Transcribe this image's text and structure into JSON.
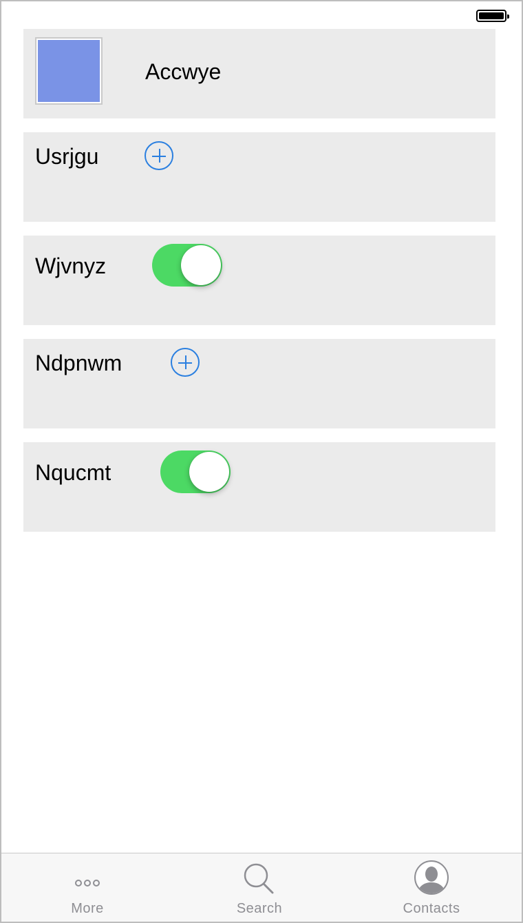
{
  "rows": [
    {
      "label": "Accwye",
      "control": "thumbnail"
    },
    {
      "label": "Usrjgu",
      "control": "add-button"
    },
    {
      "label": "Wjvnyz",
      "control": "toggle",
      "on": true
    },
    {
      "label": "Ndpnwm",
      "control": "add-button"
    },
    {
      "label": "Nqucmt",
      "control": "toggle",
      "on": true
    }
  ],
  "colors": {
    "cell_bg": "#ebebeb",
    "thumbnail": "#7a93e6",
    "add_icon": "#2a7fe0",
    "toggle_on": "#4cd964",
    "tab_inactive": "#8e8e93"
  },
  "tabbar": {
    "tabs": [
      {
        "label": "More",
        "icon": "more-icon"
      },
      {
        "label": "Search",
        "icon": "search-icon"
      },
      {
        "label": "Contacts",
        "icon": "contacts-icon"
      }
    ]
  }
}
